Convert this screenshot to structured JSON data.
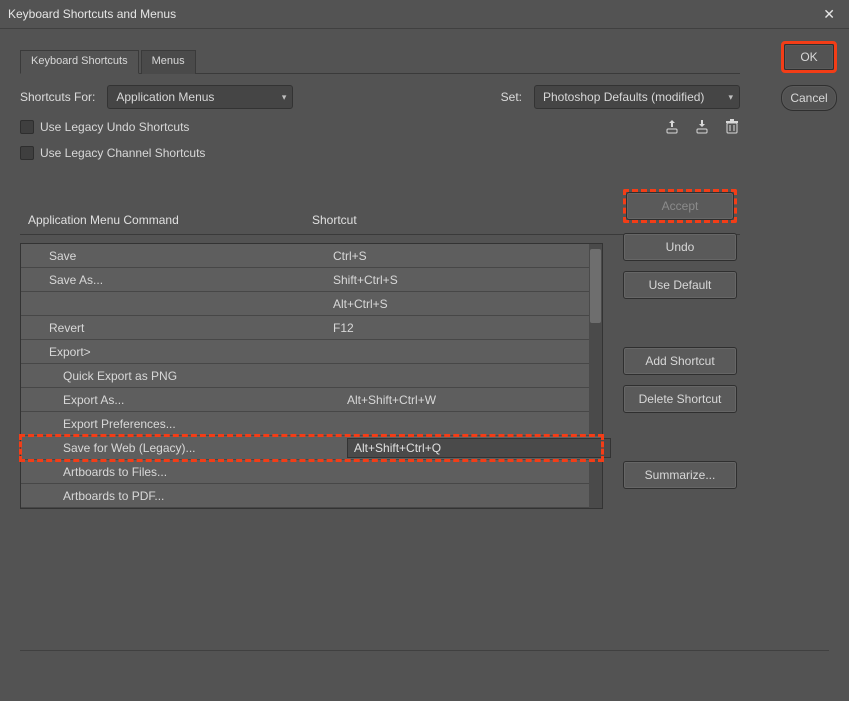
{
  "window": {
    "title": "Keyboard Shortcuts and Menus"
  },
  "buttons": {
    "ok": "OK",
    "cancel": "Cancel",
    "accept": "Accept",
    "undo": "Undo",
    "use_default": "Use Default",
    "add_shortcut": "Add Shortcut",
    "delete_shortcut": "Delete Shortcut",
    "summarize": "Summarize..."
  },
  "tabs": {
    "keyboard_shortcuts": "Keyboard Shortcuts",
    "menus": "Menus"
  },
  "form": {
    "shortcuts_for_label": "Shortcuts For:",
    "shortcuts_for_value": "Application Menus",
    "set_label": "Set:",
    "set_value": "Photoshop Defaults (modified)",
    "legacy_undo": "Use Legacy Undo Shortcuts",
    "legacy_channel": "Use Legacy Channel Shortcuts"
  },
  "table": {
    "headers": {
      "command": "Application Menu Command",
      "shortcut": "Shortcut"
    },
    "rows": [
      {
        "level": 1,
        "command": "Save",
        "shortcut": "Ctrl+S"
      },
      {
        "level": 1,
        "command": "Save As...",
        "shortcut": "Shift+Ctrl+S"
      },
      {
        "level": 1,
        "command": "",
        "shortcut": "Alt+Ctrl+S"
      },
      {
        "level": 1,
        "command": "Revert",
        "shortcut": "F12"
      },
      {
        "level": 1,
        "command": "Export>",
        "shortcut": ""
      },
      {
        "level": 2,
        "command": "Quick Export as PNG",
        "shortcut": ""
      },
      {
        "level": 2,
        "command": "Export As...",
        "shortcut": "Alt+Shift+Ctrl+W"
      },
      {
        "level": 2,
        "command": "Export Preferences...",
        "shortcut": ""
      },
      {
        "level": 2,
        "command": "Save for Web (Legacy)...",
        "shortcut": "Alt+Shift+Ctrl+Q",
        "highlight": true,
        "editing": true
      },
      {
        "level": 2,
        "command": "Artboards to Files...",
        "shortcut": ""
      },
      {
        "level": 2,
        "command": "Artboards to PDF...",
        "shortcut": ""
      }
    ]
  }
}
